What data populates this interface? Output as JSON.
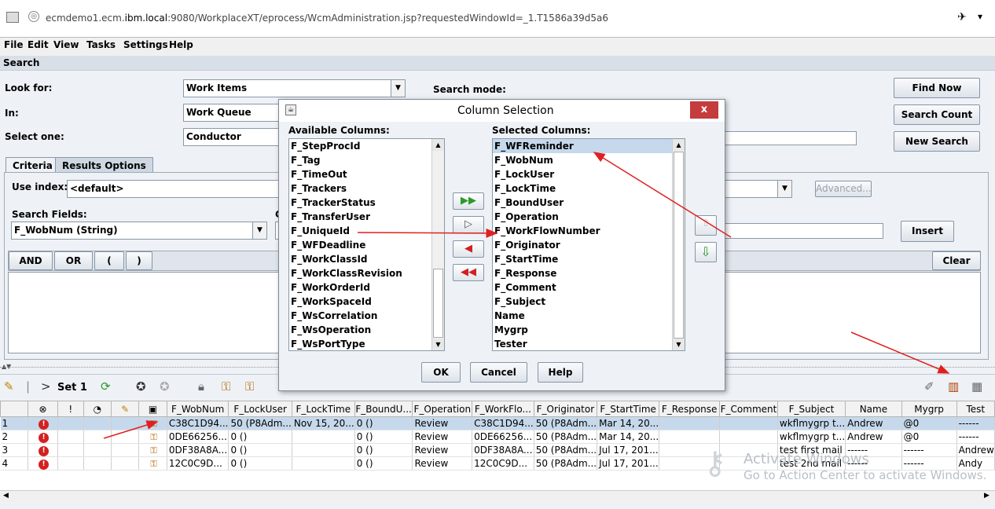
{
  "browser": {
    "url_prefix": "ecmdemo1.ecm.",
    "url_host": "ibm.local",
    "url_rest": ":9080/WorkplaceXT/eprocess/WcmAdministration.jsp?requestedWindowId=_1.T1586a39d5a6"
  },
  "menu": [
    "File",
    "Edit",
    "View",
    "Tasks",
    "Settings",
    "Help"
  ],
  "section_title": "Search",
  "search": {
    "look_for_label": "Look for:",
    "look_for_value": "Work Items",
    "in_label": "In:",
    "in_value": "Work Queue",
    "select_one_label": "Select one:",
    "select_one_value": "Conductor",
    "search_mode_label": "Search mode:",
    "find_now": "Find Now",
    "search_count": "Search Count",
    "new_search": "New Search"
  },
  "tabs": [
    "Criteria",
    "Results Options"
  ],
  "criteria": {
    "use_index_label": "Use index:",
    "use_index_value": "<default>",
    "advanced": "Advanced...",
    "search_fields_label": "Search Fields:",
    "search_fields_value": "F_WobNum (String)",
    "c_label": "C",
    "insert": "Insert",
    "ops": [
      "AND",
      "OR",
      "(",
      ")"
    ],
    "clear": "Clear"
  },
  "dialog": {
    "title": "Column Selection",
    "close": "x",
    "available_label": "Available Columns:",
    "selected_label": "Selected Columns:",
    "available": [
      "F_StepProcId",
      "F_Tag",
      "F_TimeOut",
      "F_Trackers",
      "F_TrackerStatus",
      "F_TransferUser",
      "F_UniqueId",
      "F_WFDeadline",
      "F_WorkClassId",
      "F_WorkClassRevision",
      "F_WorkOrderId",
      "F_WorkSpaceId",
      "F_WsCorrelation",
      "F_WsOperation",
      "F_WsPortType"
    ],
    "selected": [
      "F_WFReminder",
      "F_WobNum",
      "F_LockUser",
      "F_LockTime",
      "F_BoundUser",
      "F_Operation",
      "F_WorkFlowNumber",
      "F_Originator",
      "F_StartTime",
      "F_Response",
      "F_Comment",
      "F_Subject",
      "Name",
      "Mygrp",
      "Tester"
    ],
    "ok": "OK",
    "cancel": "Cancel",
    "help": "Help"
  },
  "toolbar": {
    "set_label": "Set 1"
  },
  "grid": {
    "columns": [
      "",
      "⊗",
      "!",
      "",
      "",
      "",
      "F_WobNum",
      "F_LockUser",
      "F_LockTime",
      "F_BoundU...",
      "F_Operation",
      "F_WorkFlo...",
      "F_Originator",
      "F_StartTime",
      "F_Response",
      "F_Comment",
      "F_Subject",
      "Name",
      "Mygrp",
      "Test"
    ],
    "rows": [
      [
        "1",
        "C38C1D94...",
        "50 (P8Adm...",
        "Nov 15, 20...",
        "0 ()",
        "Review",
        "C38C1D94...",
        "50 (P8Adm...",
        "Mar 14, 20...",
        "",
        "",
        "wkflmygrp t...",
        "Andrew",
        "@0",
        "------"
      ],
      [
        "2",
        "0DE66256...",
        "0 ()",
        "",
        "0 ()",
        "Review",
        "0DE66256...",
        "50 (P8Adm...",
        "Mar 14, 20...",
        "",
        "",
        "wkflmygrp t...",
        "Andrew",
        "@0",
        "------"
      ],
      [
        "3",
        "0DF38A8A...",
        "0 ()",
        "",
        "0 ()",
        "Review",
        "0DF38A8A...",
        "50 (P8Adm...",
        "Jul 17, 201...",
        "",
        "",
        "test first mail",
        "------",
        "------",
        "Andrew"
      ],
      [
        "4",
        "12C0C9D...",
        "0 ()",
        "",
        "0 ()",
        "Review",
        "12C0C9D...",
        "50 (P8Adm...",
        "Jul 17, 201...",
        "",
        "",
        "test 2nd mail",
        "------",
        "------",
        "Andy"
      ]
    ]
  },
  "watermark": {
    "line1": "Activate Windows",
    "line2": "Go to Action Center to activate Windows."
  },
  "colors": {
    "annotation_arrow": "#e02020",
    "selection": "#c6d9ec"
  }
}
